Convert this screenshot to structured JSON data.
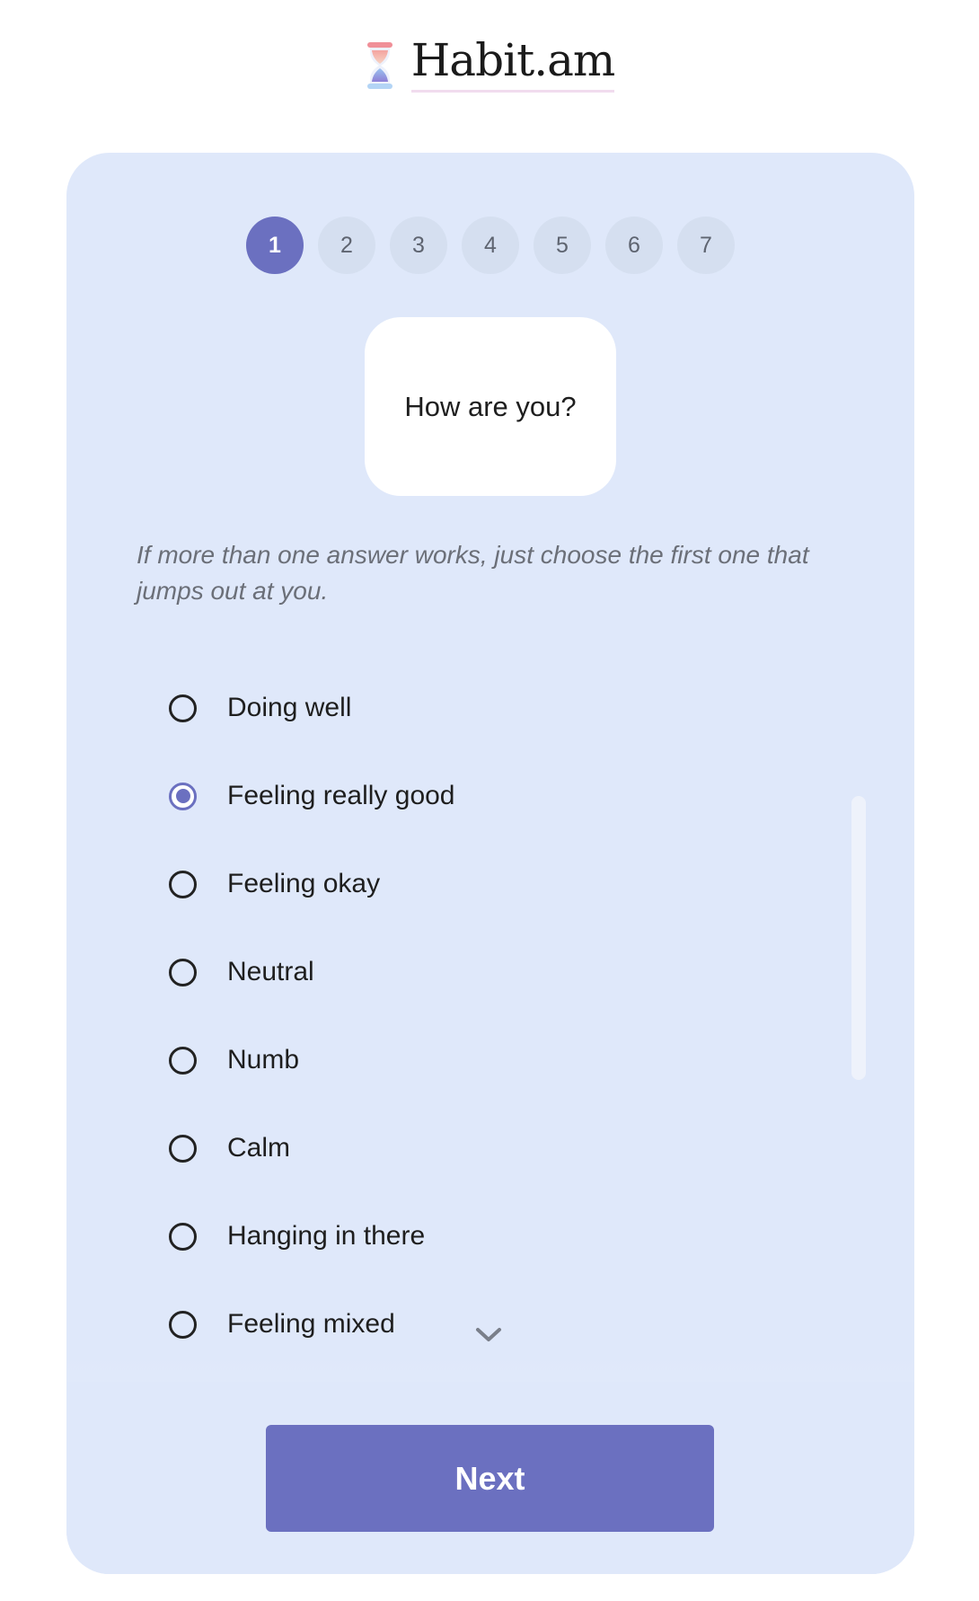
{
  "header": {
    "logo_icon": "hourglass-icon",
    "brand": "Habit.am"
  },
  "steps": {
    "items": [
      "1",
      "2",
      "3",
      "4",
      "5",
      "6",
      "7"
    ],
    "current": "1"
  },
  "question": {
    "text": "How are you?",
    "hint": "If more than one answer works, just choose the first one that jumps out at you."
  },
  "options": {
    "items": [
      {
        "label": "Doing well",
        "selected": false
      },
      {
        "label": "Feeling really good",
        "selected": true
      },
      {
        "label": "Feeling okay",
        "selected": false
      },
      {
        "label": "Neutral",
        "selected": false
      },
      {
        "label": "Numb",
        "selected": false
      },
      {
        "label": "Calm",
        "selected": false
      },
      {
        "label": "Hanging in there",
        "selected": false
      },
      {
        "label": "Feeling mixed",
        "selected": false
      }
    ],
    "more_icon": "chevron-down-icon"
  },
  "actions": {
    "next_label": "Next"
  },
  "colors": {
    "accent": "#6b70c0",
    "card_background": "#dfe8fa",
    "step_inactive": "#d5dff0"
  }
}
